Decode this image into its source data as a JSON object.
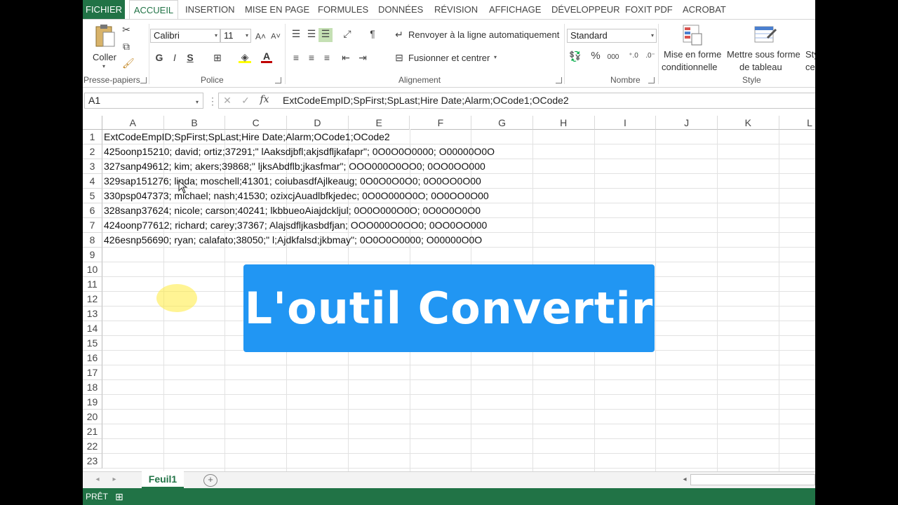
{
  "tabs": [
    "FICHIER",
    "ACCUEIL",
    "INSERTION",
    "MISE EN PAGE",
    "FORMULES",
    "DONNÉES",
    "RÉVISION",
    "AFFICHAGE",
    "DÉVELOPPEUR",
    "FOXIT PDF",
    "ACROBAT"
  ],
  "ribbon": {
    "clipboard": {
      "paste_label": "Coller",
      "group": "Presse-papiers"
    },
    "font": {
      "name": "Calibri",
      "size": "11",
      "bold": "G",
      "italic": "I",
      "underline": "S",
      "group": "Police"
    },
    "alignment": {
      "wrap": "Renvoyer à la ligne automatiquement",
      "merge": "Fusionner et centrer",
      "group": "Alignement"
    },
    "number": {
      "format": "Standard",
      "percent": "%",
      "thousands": "000",
      "group": "Nombre"
    },
    "style": {
      "conditional_1": "Mise en forme",
      "conditional_2": "conditionnelle",
      "table_1": "Mettre sous forme",
      "table_2": "de tableau",
      "cell_1": "Sty",
      "cell_2": "cel",
      "group": "Style"
    }
  },
  "formula_bar": {
    "name_box": "A1",
    "fx": "fx",
    "formula": "ExtCodeEmpID;SpFirst;SpLast;Hire Date;Alarm;OCode1;OCode2"
  },
  "columns": [
    "A",
    "B",
    "C",
    "D",
    "E",
    "F",
    "G",
    "H",
    "I",
    "J",
    "K",
    "L"
  ],
  "rows": [
    "1",
    "2",
    "3",
    "4",
    "5",
    "6",
    "7",
    "8",
    "9",
    "10",
    "11",
    "12",
    "13",
    "14",
    "15",
    "16",
    "17",
    "18",
    "19",
    "20",
    "21",
    "22",
    "23"
  ],
  "cells": [
    "ExtCodeEmpID;SpFirst;SpLast;Hire Date;Alarm;OCode1;OCode2",
    "425oonp15210; david; ortiz;37291;\" lAaksdjbfl;akjsdfljkafapr\"; 0O0O0O0000; O00000O0O",
    "327sanp49612; kim; akers;39868;\" ljksAbdflb;jkasfmar\"; OOO000O0OO0; 0OO0OO000",
    "329sap151276; linda; moschell;41301; coiubasdfAjlkeaug; 0O0O0O0O0; 0O0OO0O00",
    "330psp047373; michael; nash;41530; ozixcjAuadlbfkjedec; 0O0O000O0O; 0O0OO0O00",
    "328sanp37624; nicole; carson;40241; lkbbueoAiajdckljul; 0O0O000O0O; 0O0O0O0O0",
    "424oonp77612; richard; carey;37367; Alajsdfljkasbdfjan; OOO000O0OO0; 0OO0OO000",
    "426esnp56690; ryan; calafato;38050;\" l;Ajdkfalsd;jkbmay\"; 0O0O0O0000; O00000O0O"
  ],
  "overlay_title": "L'outil Convertir",
  "sheet_tab": "Feuil1",
  "status": "PRÊT"
}
